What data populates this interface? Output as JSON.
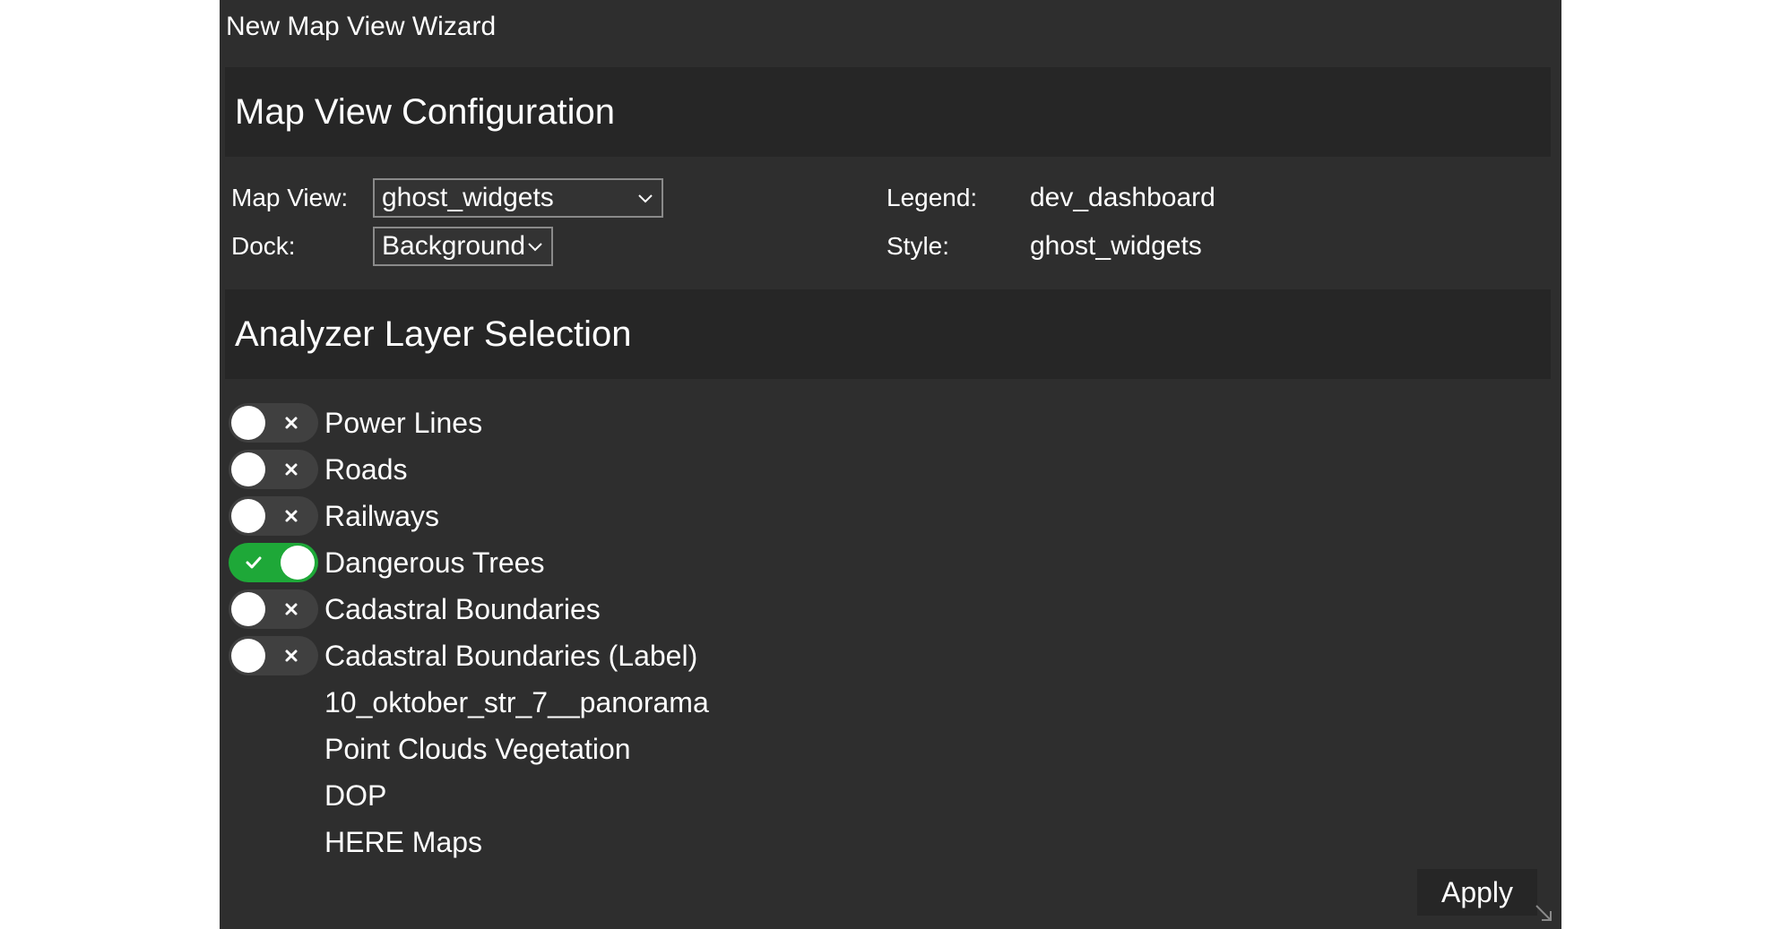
{
  "window": {
    "title": "New Map View Wizard"
  },
  "config": {
    "header": "Map View Configuration",
    "map_view_label": "Map View:",
    "map_view_value": "ghost_widgets",
    "dock_label": "Dock:",
    "dock_value": "Background",
    "legend_label": "Legend:",
    "legend_value": "dev_dashboard",
    "style_label": "Style:",
    "style_value": "ghost_widgets"
  },
  "layers": {
    "header": "Analyzer Layer Selection",
    "items": [
      {
        "name": "Power Lines",
        "toggle": "off"
      },
      {
        "name": "Roads",
        "toggle": "off"
      },
      {
        "name": "Railways",
        "toggle": "off"
      },
      {
        "name": "Dangerous Trees",
        "toggle": "on"
      },
      {
        "name": "Cadastral Boundaries",
        "toggle": "off"
      },
      {
        "name": "Cadastral Boundaries (Label)",
        "toggle": "off"
      },
      {
        "name": "10_oktober_str_7__panorama",
        "toggle": "none"
      },
      {
        "name": "Point Clouds Vegetation",
        "toggle": "none"
      },
      {
        "name": "DOP",
        "toggle": "none"
      },
      {
        "name": "HERE Maps",
        "toggle": "none"
      }
    ]
  },
  "footer": {
    "apply_label": "Apply"
  },
  "colors": {
    "background": "#2e2e2e",
    "section": "#262626",
    "toggle_on": "#1ea838",
    "toggle_off": "#404040"
  },
  "icons": [
    "chevron-down-icon",
    "check-icon",
    "close-icon",
    "resize-grip-icon"
  ]
}
